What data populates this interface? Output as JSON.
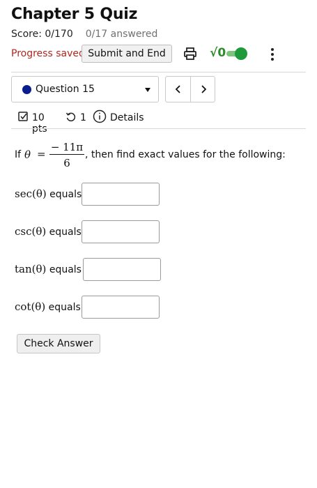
{
  "header": {
    "title": "Chapter 5 Quiz",
    "score": "Score: 0/170",
    "answered": "0/17 answered",
    "progress_status": "Progress saved",
    "submit_label": "Submit and End",
    "math_toggle_label": "√0",
    "math_toggle_on": true
  },
  "navigation": {
    "question_label": "Question 15",
    "prev_symbol": "<",
    "next_symbol": ">"
  },
  "question_meta": {
    "points": "10 pts",
    "retries": "1",
    "details_label": "Details"
  },
  "question": {
    "prefix": "If",
    "variable": "θ",
    "equals": "=",
    "fraction_numerator": "− 11π",
    "fraction_denominator": "6",
    "suffix": ", then find exact values for the following:"
  },
  "answers": [
    {
      "function": "sec(θ)",
      "label": " equals",
      "value": ""
    },
    {
      "function": "csc(θ)",
      "label": " equals",
      "value": ""
    },
    {
      "function": "tan(θ)",
      "label": " equals",
      "value": ""
    },
    {
      "function": "cot(θ)",
      "label": " equals",
      "value": ""
    }
  ],
  "check_answer_label": "Check Answer",
  "colors": {
    "progress_saved": "#b3261e",
    "question_dot": "#0a1d8f",
    "toggle_green": "#1f9a3a"
  },
  "icons": [
    "printer-icon",
    "sqrt-icon",
    "more-vertical-icon",
    "chevron-left-icon",
    "chevron-right-icon",
    "checkbox-icon",
    "retry-icon",
    "info-icon",
    "caret-down-icon"
  ]
}
